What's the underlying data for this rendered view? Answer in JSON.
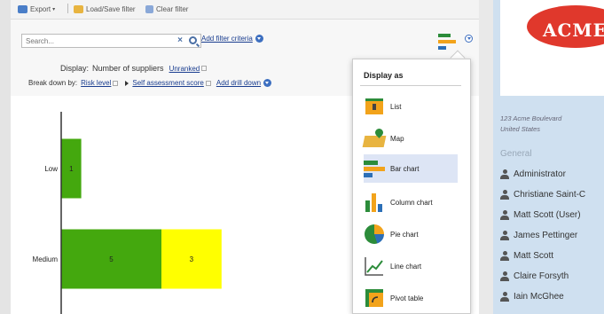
{
  "toolbar": {
    "export_label": "Export",
    "load_save_label": "Load/Save filter",
    "clear_label": "Clear filter"
  },
  "search": {
    "placeholder": "Search...",
    "add_filter_label": "Add filter criteria"
  },
  "display": {
    "prefix": "Display:",
    "value": "Number of suppliers",
    "unranked_label": "Unranked"
  },
  "breakdown": {
    "prefix": "Break down by:",
    "level1": "Risk level",
    "level2": "Self assessment score",
    "add_drill_label": "Add drill down"
  },
  "menu": {
    "title": "Display as",
    "items": [
      {
        "label": "List",
        "icon": "list-icon"
      },
      {
        "label": "Map",
        "icon": "map-icon"
      },
      {
        "label": "Bar chart",
        "icon": "bar-chart-icon",
        "selected": true
      },
      {
        "label": "Column chart",
        "icon": "column-chart-icon"
      },
      {
        "label": "Pie chart",
        "icon": "pie-chart-icon"
      },
      {
        "label": "Line chart",
        "icon": "line-chart-icon"
      },
      {
        "label": "Pivot table",
        "icon": "pivot-table-icon"
      }
    ]
  },
  "chart_data": {
    "type": "bar",
    "orientation": "horizontal",
    "stacked": true,
    "categories": [
      "Low",
      "Medium"
    ],
    "series": [
      {
        "values": [
          1,
          5
        ],
        "color": "#44a80e"
      },
      {
        "values": [
          0,
          3
        ],
        "color": "#ffff00"
      }
    ]
  },
  "right_panel": {
    "logo_text": "ACME",
    "address_line1": "123 Acme Boulevard",
    "address_line2": "United States",
    "section_label": "General",
    "people": [
      "Administrator",
      "Christiane Saint-C",
      "Matt Scott (User)",
      "James Pettinger",
      "Matt Scott",
      "Claire Forsyth",
      "Iain McGhee"
    ]
  },
  "colors": {
    "link": "#1a3d8f",
    "accent": "#3d6fc0",
    "logo_red": "#e0382c",
    "panel_bg": "#cfe0f0"
  }
}
